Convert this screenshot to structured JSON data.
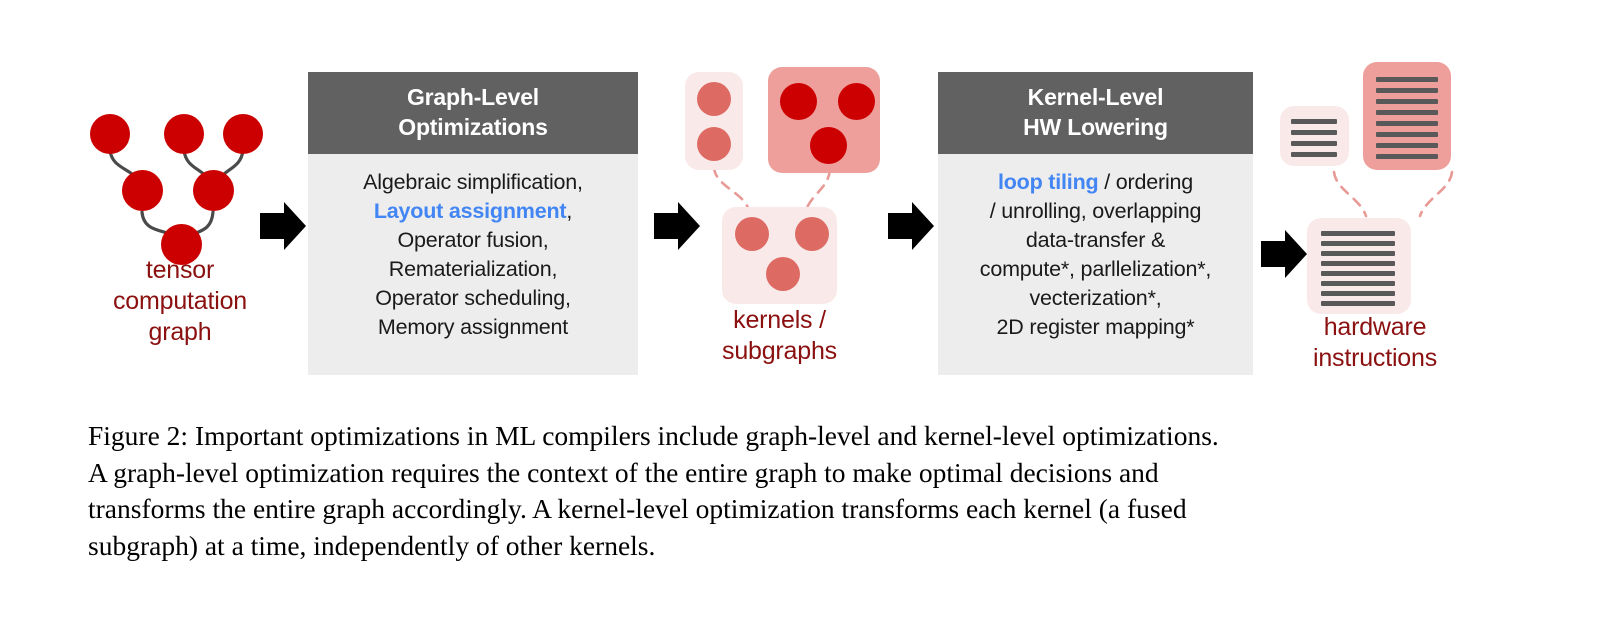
{
  "figure": {
    "caption_lines": [
      "Figure 2: Important optimizations in ML compilers include graph-level and kernel-level optimizations.",
      "A graph-level optimization requires the context of the entire graph to make optimal decisions and",
      "transforms the entire graph accordingly.  A kernel-level optimization transforms each kernel (a fused",
      "subgraph) at a time, independently of other kernels."
    ]
  },
  "stages": {
    "tensor_graph": {
      "label_lines": [
        "tensor",
        "computation",
        "graph"
      ]
    },
    "graph_level": {
      "header_lines": [
        "Graph-Level",
        "Optimizations"
      ],
      "body_lines": [
        "Algebraic simplification,",
        "Layout assignment,",
        "Operator fusion,",
        "Rematerialization,",
        "Operator scheduling,",
        "Memory assignment"
      ],
      "highlight": "Layout assignment"
    },
    "kernels": {
      "label_lines": [
        "kernels /",
        "subgraphs"
      ]
    },
    "kernel_level": {
      "header_lines": [
        "Kernel-Level",
        "HW Lowering"
      ],
      "body_lines": [
        "loop tiling / ordering",
        "/ unrolling, overlapping",
        "data-transfer &",
        "compute*, parllelization*,",
        "vecterization*,",
        "2D register mapping*"
      ],
      "highlight": "loop tiling"
    },
    "hardware": {
      "label_lines": [
        "hardware",
        "instructions"
      ]
    }
  },
  "arrows": {
    "glyph": "➤",
    "names": [
      "arrow-1",
      "arrow-2",
      "arrow-3",
      "arrow-4"
    ]
  },
  "colors": {
    "node_dark_red": "#cc0000",
    "node_light_red": "#dd6b63",
    "panel_header_gray": "#616161",
    "panel_body_gray": "#ededed",
    "highlight_blue": "#4285f4",
    "label_dark_red": "#8b1010",
    "kernel_box_pale": "#fae9e9",
    "kernel_box_deep": "#ee9e9b",
    "card_line_gray": "#595959",
    "dashed_link": "#e89a96"
  }
}
